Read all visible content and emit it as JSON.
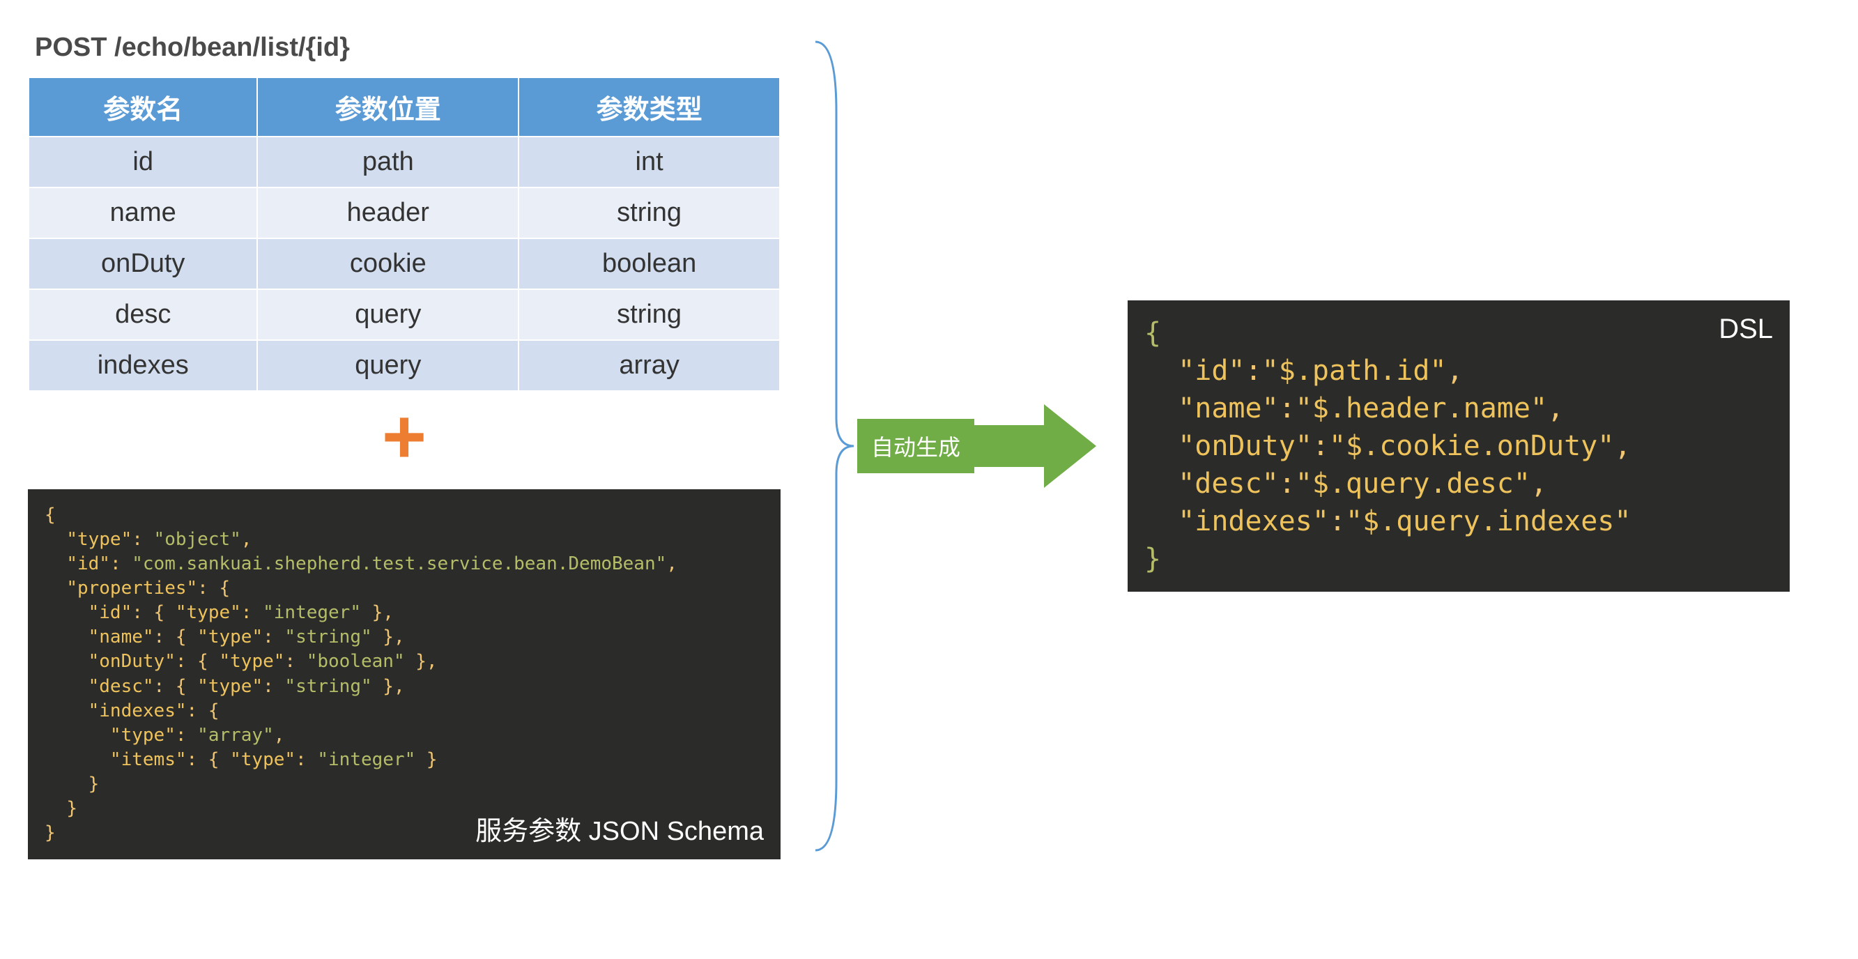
{
  "endpoint": "POST /echo/bean/list/{id}",
  "table": {
    "headers": [
      "参数名",
      "参数位置",
      "参数类型"
    ],
    "rows": [
      [
        "id",
        "path",
        "int"
      ],
      [
        "name",
        "header",
        "string"
      ],
      [
        "onDuty",
        "cookie",
        "boolean"
      ],
      [
        "desc",
        "query",
        "string"
      ],
      [
        "indexes",
        "query",
        "array"
      ]
    ]
  },
  "schema_label": "服务参数 JSON Schema",
  "schema": {
    "type": "object",
    "id": "com.sankuai.shepherd.test.service.bean.DemoBean",
    "properties": {
      "id": {
        "type": "integer"
      },
      "name": {
        "type": "string"
      },
      "onDuty": {
        "type": "boolean"
      },
      "desc": {
        "type": "string"
      },
      "indexes": {
        "type": "array",
        "items_type": "integer"
      }
    }
  },
  "arrow_label": "自动生成",
  "dsl_label": "DSL",
  "dsl": {
    "id": "$.path.id",
    "name": "$.header.name",
    "onDuty": "$.cookie.onDuty",
    "desc": "$.query.desc",
    "indexes": "$.query.indexes"
  }
}
